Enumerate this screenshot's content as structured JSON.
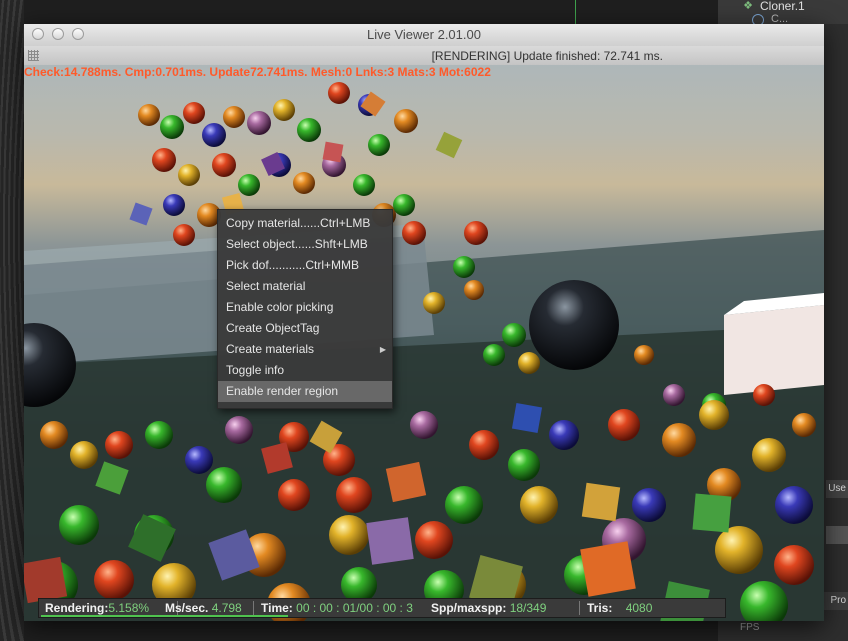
{
  "background_app": {
    "object_name": "Cloner.1",
    "object_child_label": "C...",
    "use_button": "Use",
    "pro_button": "Pro",
    "fps_label": "FPS"
  },
  "window": {
    "title": "Live Viewer 2.01.00",
    "status": "[RENDERING] Update finished: 72.741 ms."
  },
  "overlay_stats": "Check:14.788ms. Cmp:0.701ms. Update72.741ms. Mesh:0 Lnks:3 Mats:3 Mot:6022",
  "context_menu": {
    "items": [
      "Copy material......Ctrl+LMB",
      "Select object......Shft+LMB",
      "Pick dof...........Ctrl+MMB",
      "Select material",
      "Enable color picking",
      "Create ObjectTag",
      "Create materials",
      "Toggle info",
      "Enable render region"
    ],
    "highlighted_index": 8,
    "submenu_index": 6
  },
  "info_bar": {
    "rendering_label": "Rendering:",
    "rendering_value": "5.158%",
    "rendering_progress": 0.05158,
    "ms_label": "Ms/sec.",
    "ms_value": "4.798",
    "time_label": "Time:",
    "time_value": "00 : 00 : 01/00 : 00 : 3",
    "spp_label": "Spp/maxspp:",
    "spp_value": "18/349",
    "tris_label": "Tris:",
    "tris_value": "4080"
  },
  "colors": {
    "overlay_text": "#ff5a2a",
    "info_value": "#7fd17f",
    "menu_highlight": "#686868"
  }
}
